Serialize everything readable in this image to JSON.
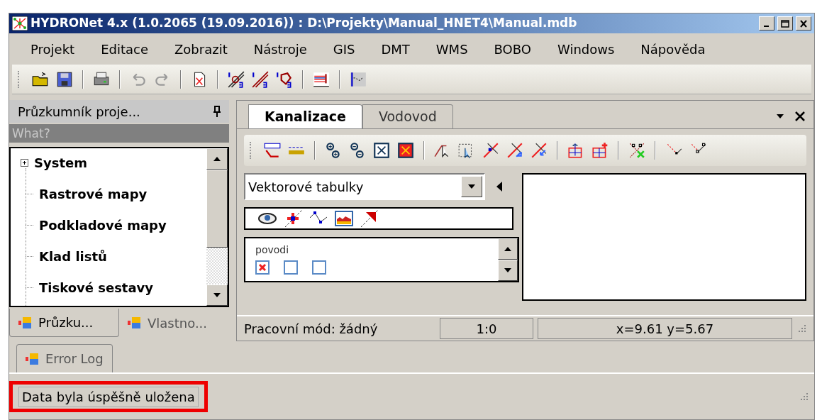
{
  "window": {
    "title": "HYDRONet 4.x (1.0.2065 (19.09.2016)) : D:\\Projekty\\Manual_HNET4\\Manual.mdb"
  },
  "menu": [
    "Projekt",
    "Editace",
    "Zobrazit",
    "Nástroje",
    "GIS",
    "DMT",
    "WMS",
    "BOBO",
    "Windows",
    "Nápověda"
  ],
  "history_buttons": [
    {
      "disabled": true
    },
    {
      "disabled": true
    }
  ],
  "explorer": {
    "title": "Průzkumník proje...",
    "search": {
      "placeholder": "What?"
    },
    "tree": [
      {
        "label": "System",
        "kind": "group",
        "expanded": false
      },
      {
        "label": "Rastrové mapy",
        "kind": "leaf"
      },
      {
        "label": "Podkladové mapy",
        "kind": "leaf"
      },
      {
        "label": "Klad listů",
        "kind": "leaf"
      },
      {
        "label": "Tiskové sestavy",
        "kind": "leaf"
      }
    ],
    "tabs": [
      {
        "label": "Průzku...",
        "selected": true
      },
      {
        "label": "Vlastno...",
        "selected": false
      }
    ]
  },
  "document_tabs": [
    {
      "label": "Kanalizace",
      "selected": true
    },
    {
      "label": "Vodovod",
      "selected": false
    }
  ],
  "layer_select": {
    "value": "Vektorové tabulky"
  },
  "layers": [
    {
      "name": "povodi",
      "flags": [
        {
          "checked": true
        },
        {
          "checked": false
        },
        {
          "checked": false
        }
      ]
    }
  ],
  "map_status": {
    "mode": "Pracovní mód: žádný",
    "scale": "1:0",
    "coords": "x=9.61 y=5.67"
  },
  "bottom_tabs": [
    {
      "label": "Error Log",
      "selected": true
    }
  ],
  "status_bar": {
    "message": "Data byla úspěšně uložena",
    "highlighted": true
  }
}
